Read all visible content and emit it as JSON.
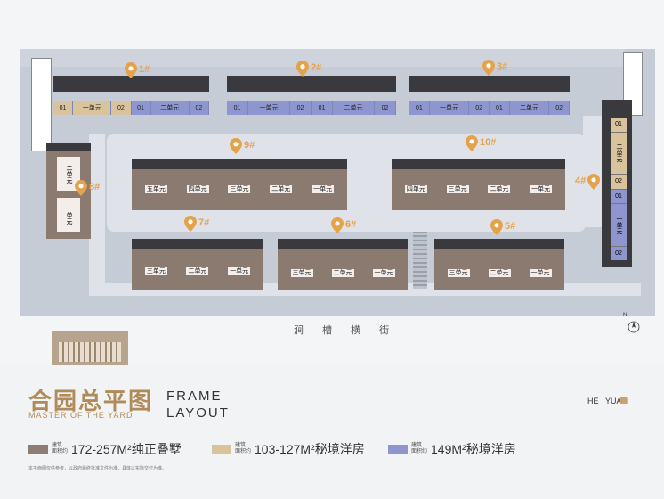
{
  "buildings": [
    {
      "id": "b1",
      "pin": "1#",
      "units": [
        "01",
        "一单元",
        "02",
        "01",
        "二单元",
        "02"
      ]
    },
    {
      "id": "b2",
      "pin": "2#",
      "units": [
        "01",
        "一单元",
        "02",
        "01",
        "二单元",
        "02"
      ]
    },
    {
      "id": "b3",
      "pin": "3#",
      "units": [
        "01",
        "一单元",
        "02",
        "01",
        "二单元",
        "02"
      ]
    },
    {
      "id": "b4",
      "pin": "4#",
      "units": [
        "01",
        "二单元",
        "02",
        "01",
        "一单元",
        "02"
      ]
    },
    {
      "id": "b5",
      "pin": "5#",
      "units": [
        "三单元",
        "二单元",
        "一单元"
      ]
    },
    {
      "id": "b6",
      "pin": "6#",
      "units": [
        "三单元",
        "二单元",
        "一单元"
      ]
    },
    {
      "id": "b7",
      "pin": "7#",
      "units": [
        "三单元",
        "二单元",
        "一单元"
      ]
    },
    {
      "id": "b8",
      "pin": "8#",
      "units": [
        "二单元",
        "一单元"
      ]
    },
    {
      "id": "b9",
      "pin": "9#",
      "units": [
        "五单元",
        "四单元",
        "三单元",
        "二单元",
        "一单元"
      ]
    },
    {
      "id": "b10",
      "pin": "10#",
      "units": [
        "四单元",
        "三单元",
        "二单元",
        "一单元"
      ]
    }
  ],
  "street": "涧 槽 横 街",
  "compass": {
    "label": "N"
  },
  "title_cn": "合园总平图",
  "title_en": "MASTER OF THE YARD",
  "frame_line1": "FRAME",
  "frame_line2": "LAYOUT",
  "brand_v1": "HE",
  "brand_v2": "YUAN",
  "legend": [
    {
      "label_top": "建筑",
      "label_bottom": "面积约",
      "text": "172-257M²纯正叠墅",
      "color": "#8d7d73"
    },
    {
      "label_top": "建筑",
      "label_bottom": "面积约",
      "text": "103-127M²秘境洋房",
      "color": "#d8c39c"
    },
    {
      "label_top": "建筑",
      "label_bottom": "面积约",
      "text": "149M²秘境洋房",
      "color": "#8e96cf"
    }
  ],
  "disclaimer": "本平面图仅供参考，以政府最终批准文件为准，具体以实际交付为准。"
}
